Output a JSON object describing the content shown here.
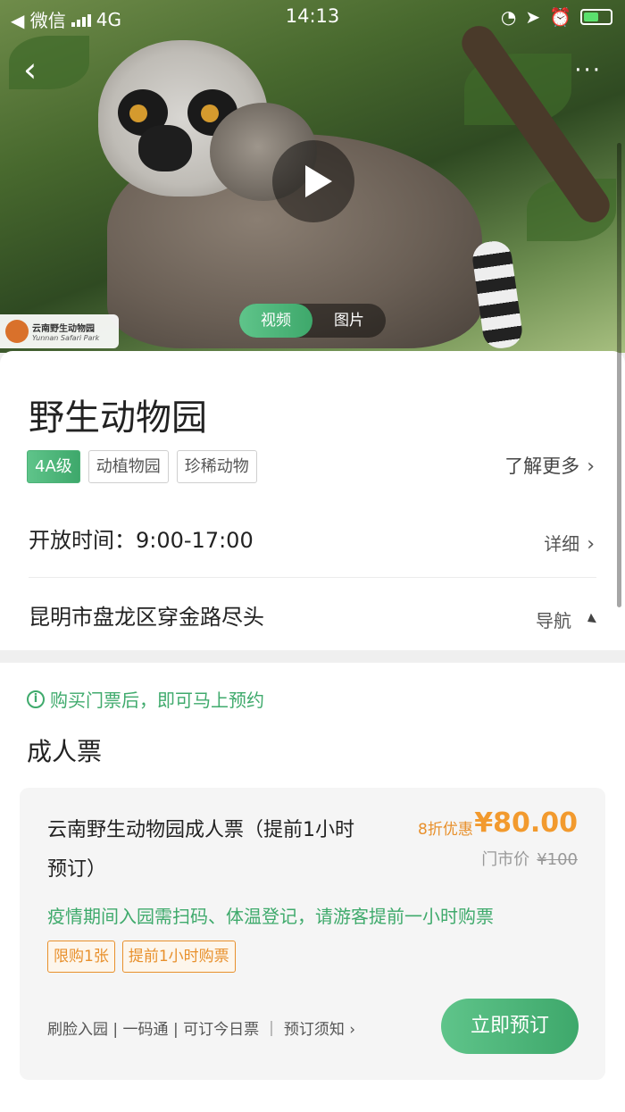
{
  "status_bar": {
    "back_app": "◀ 微信",
    "network": "4G",
    "time": "14:13"
  },
  "hero": {
    "logo_cn": "云南野生动物园",
    "logo_en": "Yunnan Safari Park",
    "tabs": [
      {
        "label": "视频",
        "active": true
      },
      {
        "label": "图片",
        "active": false
      }
    ],
    "more_label": "···"
  },
  "info": {
    "title": "野生动物园",
    "tags": [
      {
        "label": "4A级"
      },
      {
        "label": "动植物园"
      },
      {
        "label": "珍稀动物"
      }
    ],
    "learn_more": "了解更多",
    "hours_text": "开放时间：9:00-17:00",
    "hours_action": "详细",
    "address": "昆明市盘龙区穿金路尽头",
    "address_action": "导航"
  },
  "tickets": {
    "notice": "购买门票后，即可马上预约",
    "section_title": "成人票",
    "item": {
      "name": "云南野生动物园成人票（提前1小时预订）",
      "discount": "8折优惠",
      "price": "¥80.00",
      "market_label": "门市价",
      "market_price": "¥100",
      "notice": "疫情期间入园需扫码、体温登记，请游客提前一小时购票",
      "limits": [
        "限购1张",
        "提前1小时购票"
      ],
      "features": "刷脸入园 | 一码通 | 可订今日票 ｜ 预订须知 ›",
      "book_label": "立即预订"
    }
  },
  "colors": {
    "accent_green": "#3faa6c",
    "price_orange": "#f29a2e"
  }
}
